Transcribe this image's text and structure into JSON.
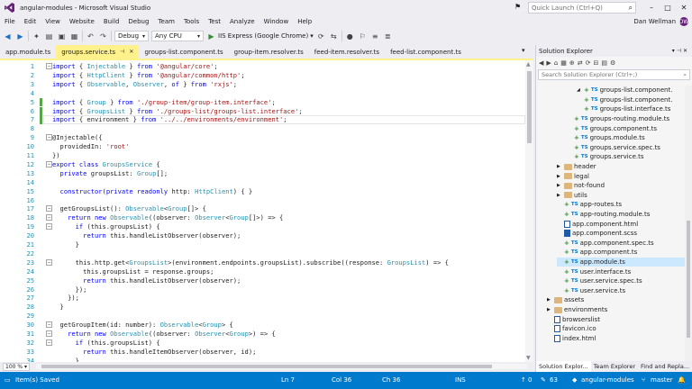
{
  "window": {
    "title": "angular-modules - Microsoft Visual Studio",
    "quick_launch_placeholder": "Quick Launch (Ctrl+Q)",
    "user_name": "Dan Wellman",
    "user_initials": "DW"
  },
  "menu": [
    "File",
    "Edit",
    "View",
    "Website",
    "Build",
    "Debug",
    "Team",
    "Tools",
    "Test",
    "Analyze",
    "Window",
    "Help"
  ],
  "toolbar": {
    "config": "Debug",
    "platform": "Any CPU",
    "run_target": "IIS Express (Google Chrome)"
  },
  "tabs": [
    {
      "label": "app.module.ts",
      "active": false
    },
    {
      "label": "groups.service.ts",
      "active": true
    },
    {
      "label": "groups-list.component.ts",
      "active": false
    },
    {
      "label": "group-item.resolver.ts",
      "active": false
    },
    {
      "label": "feed-item.resolver.ts",
      "active": false
    },
    {
      "label": "feed-list.component.ts",
      "active": false
    }
  ],
  "code_lines": [
    {
      "n": "1",
      "t": "import { Injectable } from '@angular/core';"
    },
    {
      "n": "2",
      "t": "import { HttpClient } from '@angular/common/http';"
    },
    {
      "n": "3",
      "t": "import { Observable, Observer, of } from 'rxjs';"
    },
    {
      "n": "4",
      "t": ""
    },
    {
      "n": "5",
      "t": "import { Group } from './group-item/group-item.interface';"
    },
    {
      "n": "6",
      "t": "import { GroupsList } from './groups-list/groups-list.interface';"
    },
    {
      "n": "7",
      "t": "import { environment } from '../../environments/environment';"
    },
    {
      "n": "8",
      "t": ""
    },
    {
      "n": "9",
      "t": "@Injectable({"
    },
    {
      "n": "10",
      "t": "  providedIn: 'root'"
    },
    {
      "n": "11",
      "t": "})"
    },
    {
      "n": "12",
      "t": "export class GroupsService {"
    },
    {
      "n": "13",
      "t": "  private groupsList: Group[];"
    },
    {
      "n": "14",
      "t": ""
    },
    {
      "n": "15",
      "t": "  constructor(private readonly http: HttpClient) { }"
    },
    {
      "n": "16",
      "t": ""
    },
    {
      "n": "17",
      "t": "  getGroupsList(): Observable<Group[]> {"
    },
    {
      "n": "18",
      "t": "    return new Observable((observer: Observer<Group[]>) => {"
    },
    {
      "n": "19",
      "t": "      if (this.groupsList) {"
    },
    {
      "n": "20",
      "t": "        return this.handleListObserver(observer);"
    },
    {
      "n": "21",
      "t": "      }"
    },
    {
      "n": "22",
      "t": ""
    },
    {
      "n": "23",
      "t": "      this.http.get<GroupsList>(environment.endpoints.groupsList).subscribe((response: GroupsList) => {"
    },
    {
      "n": "24",
      "t": "        this.groupsList = response.groups;"
    },
    {
      "n": "25",
      "t": "        return this.handleListObserver(observer);"
    },
    {
      "n": "26",
      "t": "      });"
    },
    {
      "n": "27",
      "t": "    });"
    },
    {
      "n": "28",
      "t": "  }"
    },
    {
      "n": "29",
      "t": ""
    },
    {
      "n": "30",
      "t": "  getGroupItem(id: number): Observable<Group> {"
    },
    {
      "n": "31",
      "t": "    return new Observable((observer: Observer<Group>) => {"
    },
    {
      "n": "32",
      "t": "      if (this.groupsList) {"
    },
    {
      "n": "33",
      "t": "        return this.handleItemObserver(observer, id);"
    },
    {
      "n": "34",
      "t": "      }"
    }
  ],
  "zoom": "100 %",
  "solution_explorer": {
    "title": "Solution Explorer",
    "search_placeholder": "Search Solution Explorer (Ctrl+;)",
    "items": [
      {
        "label": "groups-list.component.",
        "icon": "ts",
        "level": 5,
        "expander": "expanded"
      },
      {
        "label": "groups-list.component.",
        "icon": "ts",
        "level": 5,
        "expander": ""
      },
      {
        "label": "groups-list.interface.ts",
        "icon": "ts",
        "level": 5,
        "expander": ""
      },
      {
        "label": "groups-routing.module.ts",
        "icon": "ts",
        "level": 4,
        "expander": ""
      },
      {
        "label": "groups.component.ts",
        "icon": "ts",
        "level": 4,
        "expander": ""
      },
      {
        "label": "groups.module.ts",
        "icon": "ts",
        "level": 4,
        "expander": ""
      },
      {
        "label": "groups.service.spec.ts",
        "icon": "ts",
        "level": 4,
        "expander": ""
      },
      {
        "label": "groups.service.ts",
        "icon": "ts",
        "level": 4,
        "expander": ""
      },
      {
        "label": "header",
        "icon": "folder",
        "level": 3,
        "expander": "collapsed"
      },
      {
        "label": "legal",
        "icon": "folder",
        "level": 3,
        "expander": "collapsed"
      },
      {
        "label": "not-found",
        "icon": "folder",
        "level": 3,
        "expander": "collapsed"
      },
      {
        "label": "utils",
        "icon": "folder",
        "level": 3,
        "expander": "collapsed"
      },
      {
        "label": "app-routes.ts",
        "icon": "ts",
        "level": 3,
        "expander": ""
      },
      {
        "label": "app-routing.module.ts",
        "icon": "ts",
        "level": 3,
        "expander": ""
      },
      {
        "label": "app.component.html",
        "icon": "file",
        "level": 3,
        "expander": ""
      },
      {
        "label": "app.component.scss",
        "icon": "css",
        "level": 3,
        "expander": ""
      },
      {
        "label": "app.component.spec.ts",
        "icon": "ts",
        "level": 3,
        "expander": ""
      },
      {
        "label": "app.component.ts",
        "icon": "ts",
        "level": 3,
        "expander": ""
      },
      {
        "label": "app.module.ts",
        "icon": "ts",
        "level": 3,
        "expander": "",
        "selected": true
      },
      {
        "label": "user.interface.ts",
        "icon": "ts",
        "level": 3,
        "expander": ""
      },
      {
        "label": "user.service.spec.ts",
        "icon": "ts",
        "level": 3,
        "expander": ""
      },
      {
        "label": "user.service.ts",
        "icon": "ts",
        "level": 3,
        "expander": ""
      },
      {
        "label": "assets",
        "icon": "folder",
        "level": 2,
        "expander": "collapsed"
      },
      {
        "label": "environments",
        "icon": "folder",
        "level": 2,
        "expander": "collapsed"
      },
      {
        "label": "browserslist",
        "icon": "file",
        "level": 2,
        "expander": ""
      },
      {
        "label": "favicon.ico",
        "icon": "file",
        "level": 2,
        "expander": ""
      },
      {
        "label": "index.html",
        "icon": "file",
        "level": 2,
        "expander": ""
      }
    ],
    "bottom_tabs": [
      {
        "label": "Solution Explor...",
        "active": true
      },
      {
        "label": "Team Explorer",
        "active": false
      },
      {
        "label": "Find and Repla...",
        "active": false
      }
    ]
  },
  "status": {
    "left": "Item(s) Saved",
    "ln": "Ln 7",
    "col": "Col 36",
    "ch": "Ch 36",
    "ins": "INS",
    "up_count": "0",
    "edit_count": "63",
    "repo": "angular-modules",
    "branch": "master"
  },
  "colors": {
    "accent": "#007acc",
    "active_tab": "#fff28c",
    "keyword": "#0000ff",
    "string": "#a31515",
    "type": "#2b91af"
  }
}
